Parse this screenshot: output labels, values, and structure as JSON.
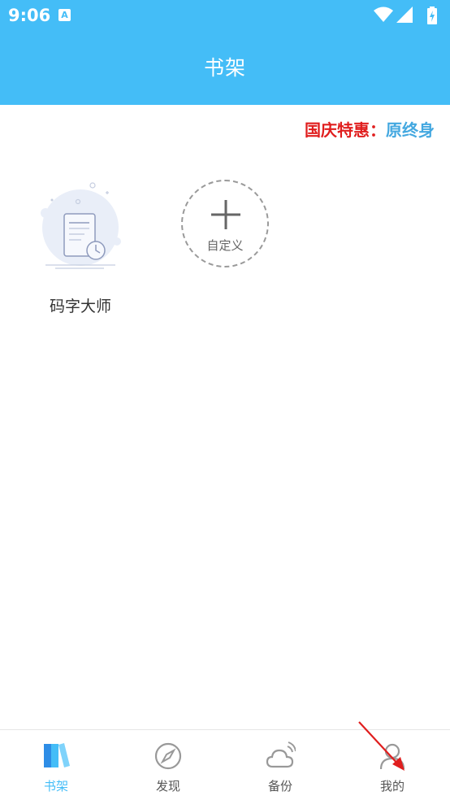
{
  "status_bar": {
    "time": "9:06",
    "app_icon_letter": "A"
  },
  "header": {
    "title": "书架"
  },
  "promo": {
    "label": "国庆特惠：",
    "text": "原终身"
  },
  "bookshelf": {
    "books": [
      {
        "name": "码字大师"
      }
    ],
    "add_label": "自定义"
  },
  "bottom_nav": {
    "items": [
      {
        "label": "书架",
        "icon": "bookshelf-icon",
        "active": true
      },
      {
        "label": "发现",
        "icon": "compass-icon",
        "active": false
      },
      {
        "label": "备份",
        "icon": "cloud-icon",
        "active": false
      },
      {
        "label": "我的",
        "icon": "user-icon",
        "active": false
      }
    ]
  },
  "colors": {
    "accent": "#44bdf7",
    "promo_label": "#e01e1e",
    "promo_text": "#44a8e0",
    "annotation": "#e01e1e"
  }
}
